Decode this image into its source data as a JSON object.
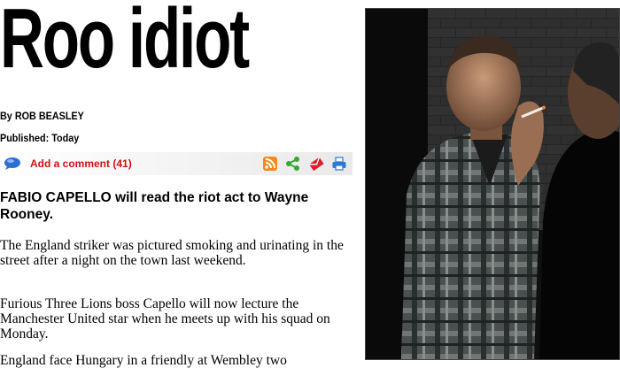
{
  "article": {
    "headline": "Roo idiot",
    "byline_prefix": "By",
    "author": "ROB BEASLEY",
    "published": "Published: Today",
    "comment_link": "Add a comment (41)",
    "standfirst": "FABIO CAPELLO will read the riot act to Wayne Rooney.",
    "paragraphs": [
      "The England striker was pictured smoking and urinating in the street after a night on the town last weekend.",
      "Furious Three Lions boss Capello will now lecture the Manchester United star when he meets up with his squad on Monday.",
      "England face Hungary in a friendly at Wembley two"
    ]
  },
  "toolbar": {
    "icons": [
      "speech-bubble-icon",
      "rss-feed-icon",
      "share-icon",
      "email-icon",
      "print-icon"
    ],
    "colors": {
      "comment": "#cc1111",
      "rss": "#f28a1e",
      "share": "#3aa635",
      "email": "#d8202a",
      "print": "#2a7ad6"
    }
  }
}
